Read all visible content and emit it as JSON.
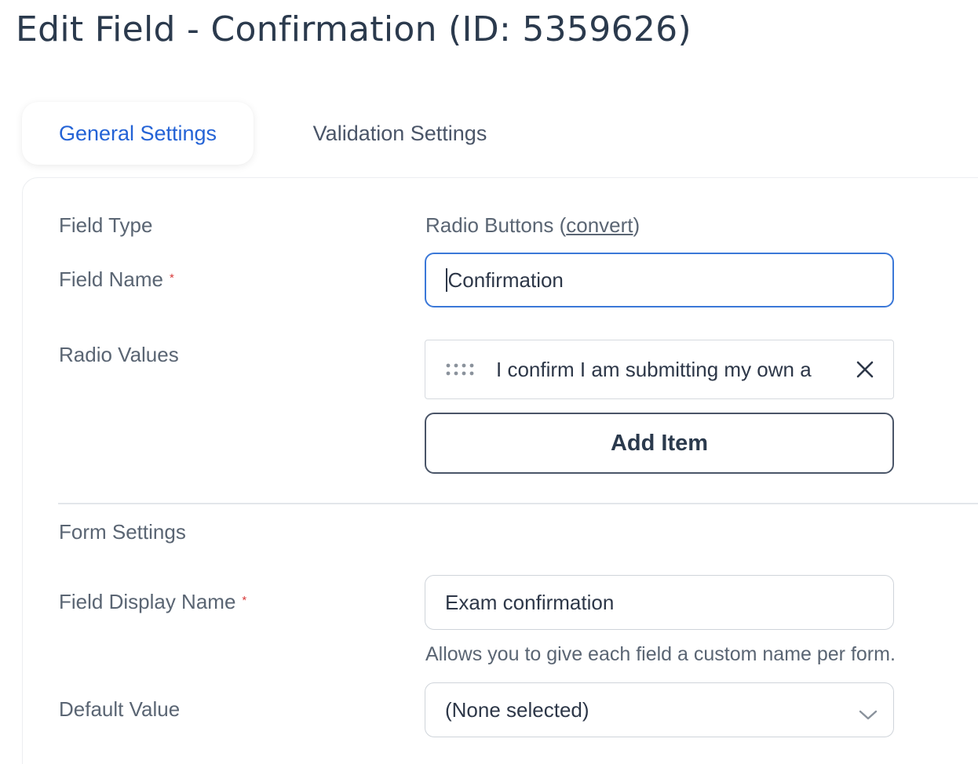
{
  "page": {
    "title": "Edit Field - Confirmation (ID: 5359626)"
  },
  "tabs": [
    {
      "label": "General Settings",
      "active": true
    },
    {
      "label": "Validation Settings",
      "active": false
    }
  ],
  "general": {
    "field_type": {
      "label": "Field Type",
      "value": "Radio Buttons",
      "paren_open": "(",
      "convert_link": "convert",
      "paren_close": ")"
    },
    "field_name": {
      "label": "Field Name",
      "required_mark": "*",
      "value": "Confirmation"
    },
    "radio_values": {
      "label": "Radio Values",
      "items": [
        {
          "text": "I confirm I am submitting my own a"
        }
      ],
      "add_button": "Add Item"
    },
    "form_settings": {
      "heading": "Form Settings",
      "display_name": {
        "label": "Field Display Name",
        "required_mark": "*",
        "value": "Exam confirmation",
        "helper": "Allows you to give each field a custom name per form."
      },
      "default_value": {
        "label": "Default Value",
        "selected": "(None selected)"
      }
    }
  },
  "icons": {
    "drag": "drag-handle-icon",
    "remove": "close-icon",
    "dropdown": "chevron-down-icon"
  },
  "colors": {
    "accent": "#2463d6",
    "focus_border": "#3b78d8",
    "required": "#d83a3a",
    "text_dark": "#2b3a4d",
    "text_muted": "#5a6573"
  }
}
